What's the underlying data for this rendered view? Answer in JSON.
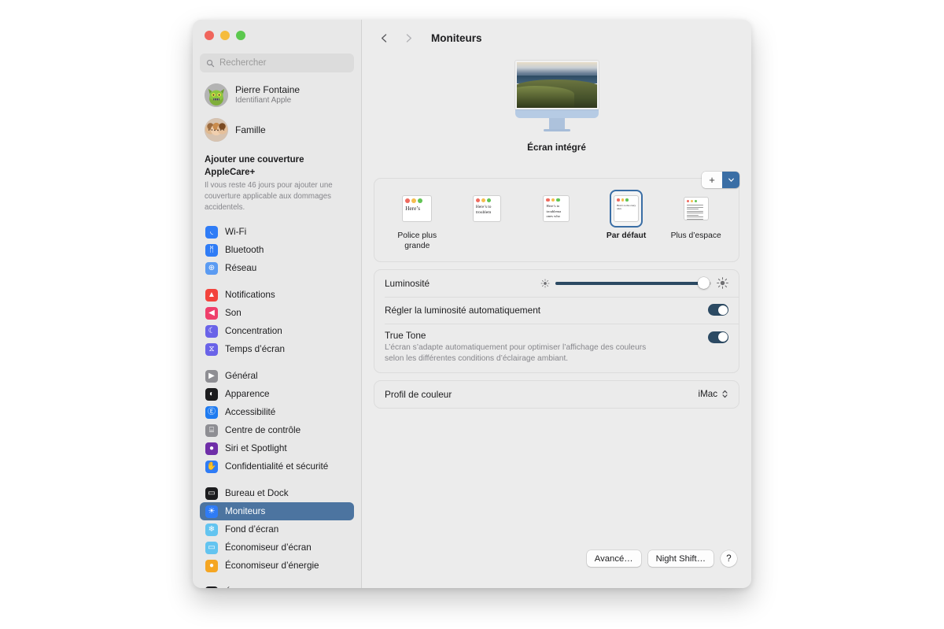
{
  "window": {
    "traffic_lights": [
      "close",
      "minimize",
      "zoom"
    ],
    "colors": {
      "close": "#f0655c",
      "minimize": "#f6bc3c",
      "zoom": "#5cc84e",
      "accent_selected": "#4c74a0",
      "accent_blue": "#3a6ea5",
      "slider_fill": "#2c4a63",
      "toggle_on": "#2c4a63"
    }
  },
  "sidebar": {
    "search": {
      "placeholder": "Rechercher",
      "value": "",
      "icon": "search-icon"
    },
    "account": {
      "name": "Pierre Fontaine",
      "subtitle": "Identifiant Apple",
      "avatar": "memoji-avatar"
    },
    "family": {
      "label": "Famille",
      "avatar": "family-avatar"
    },
    "applecare": {
      "title": "Ajouter une couverture AppleCare+",
      "body": "Il vous reste 46 jours pour ajouter une couverture applicable aux dommages accidentels.",
      "days_remaining": "46"
    },
    "groups": [
      {
        "items": [
          {
            "label": "Wi-Fi",
            "icon": "wifi-icon",
            "icon_bg": "#2f7cf6",
            "glyph": "◟",
            "selected": false
          },
          {
            "label": "Bluetooth",
            "icon": "bluetooth-icon",
            "icon_bg": "#2f7cf6",
            "glyph": "ᛗ",
            "selected": false
          },
          {
            "label": "Réseau",
            "icon": "network-globe-icon",
            "icon_bg": "#5b9bf2",
            "glyph": "⊕",
            "selected": false
          }
        ]
      },
      {
        "items": [
          {
            "label": "Notifications",
            "icon": "notifications-bell-icon",
            "icon_bg": "#f3433c",
            "glyph": "▲",
            "selected": false
          },
          {
            "label": "Son",
            "icon": "sound-speaker-icon",
            "icon_bg": "#ef3f6b",
            "glyph": "◀",
            "selected": false
          },
          {
            "label": "Concentration",
            "icon": "focus-moon-icon",
            "icon_bg": "#6a63e8",
            "glyph": "☾",
            "selected": false
          },
          {
            "label": "Temps d’écran",
            "icon": "screen-time-hourglass-icon",
            "icon_bg": "#6a63e8",
            "glyph": "⧖",
            "selected": false
          }
        ]
      },
      {
        "items": [
          {
            "label": "Général",
            "icon": "general-gear-icon",
            "icon_bg": "#8e8e93",
            "glyph": "▶",
            "selected": false
          },
          {
            "label": "Apparence",
            "icon": "appearance-icon",
            "icon_bg": "#1c1c1e",
            "glyph": "◐",
            "selected": false
          },
          {
            "label": "Accessibilité",
            "icon": "accessibility-icon",
            "icon_bg": "#1f7bf0",
            "glyph": "Ⓔ",
            "selected": false
          },
          {
            "label": "Centre de contrôle",
            "icon": "control-center-icon",
            "icon_bg": "#8e8e93",
            "glyph": "⌸",
            "selected": false
          },
          {
            "label": "Siri et Spotlight",
            "icon": "siri-icon",
            "icon_bg": "#6f2ea8",
            "glyph": "●",
            "selected": false
          },
          {
            "label": "Confidentialité et sécurité",
            "icon": "privacy-hand-icon",
            "icon_bg": "#2f7cf6",
            "glyph": "✋",
            "selected": false
          }
        ]
      },
      {
        "items": [
          {
            "label": "Bureau et Dock",
            "icon": "desktop-dock-icon",
            "icon_bg": "#1c1c1e",
            "glyph": "▭",
            "selected": false
          },
          {
            "label": "Moniteurs",
            "icon": "displays-brightness-icon",
            "icon_bg": "#2f7cf6",
            "glyph": "☀",
            "selected": true
          },
          {
            "label": "Fond d’écran",
            "icon": "wallpaper-icon",
            "icon_bg": "#63c4f0",
            "glyph": "❄",
            "selected": false
          },
          {
            "label": "Économiseur d’écran",
            "icon": "screensaver-icon",
            "icon_bg": "#63c4f0",
            "glyph": "▭",
            "selected": false
          },
          {
            "label": "Économiseur d’énergie",
            "icon": "energy-saver-bulb-icon",
            "icon_bg": "#f5a623",
            "glyph": "●",
            "selected": false
          }
        ]
      },
      {
        "items": [
          {
            "label": "Écran verrouillé",
            "icon": "lock-screen-icon",
            "icon_bg": "#1c1c1e",
            "glyph": "▮",
            "selected": false
          }
        ]
      }
    ]
  },
  "toolbar": {
    "back_icon": "chevron-left-icon",
    "forward_icon": "chevron-right-icon",
    "title": "Moniteurs"
  },
  "display": {
    "preview_name": "Écran intégré",
    "add_button": {
      "plus_label": "+",
      "chevron_icon": "chevron-down-icon"
    }
  },
  "resolutions": {
    "options": [
      {
        "label": "Police plus grande",
        "selected": false,
        "scale": "xlarge",
        "thumb_text": "Here’s"
      },
      {
        "label": "",
        "selected": false,
        "scale": "large",
        "thumb_text": "Here’s to troublem"
      },
      {
        "label": "",
        "selected": false,
        "scale": "medium",
        "thumb_text": "Here’s to troublema ones who"
      },
      {
        "label": "Par défaut",
        "selected": true,
        "scale": "default",
        "thumb_text": "Here’s to the crazy ones"
      },
      {
        "label": "Plus d’espace",
        "selected": false,
        "scale": "more-space",
        "thumb_text": ""
      }
    ]
  },
  "settings": {
    "brightness": {
      "label": "Luminosité",
      "value_percent": 95,
      "min_icon": "brightness-low-icon",
      "max_icon": "brightness-high-icon"
    },
    "auto_brightness": {
      "label": "Régler la luminosité automatiquement",
      "enabled": true
    },
    "true_tone": {
      "label": "True Tone",
      "description": "L’écran s’adapte automatiquement pour optimiser l’affichage des couleurs selon les différentes conditions d’éclairage ambiant.",
      "enabled": true
    },
    "color_profile": {
      "label": "Profil de couleur",
      "value": "iMac",
      "chevron_icon": "updown-chevron-icon"
    }
  },
  "buttons": {
    "advanced": "Avancé…",
    "night_shift": "Night Shift…",
    "help": "?"
  }
}
